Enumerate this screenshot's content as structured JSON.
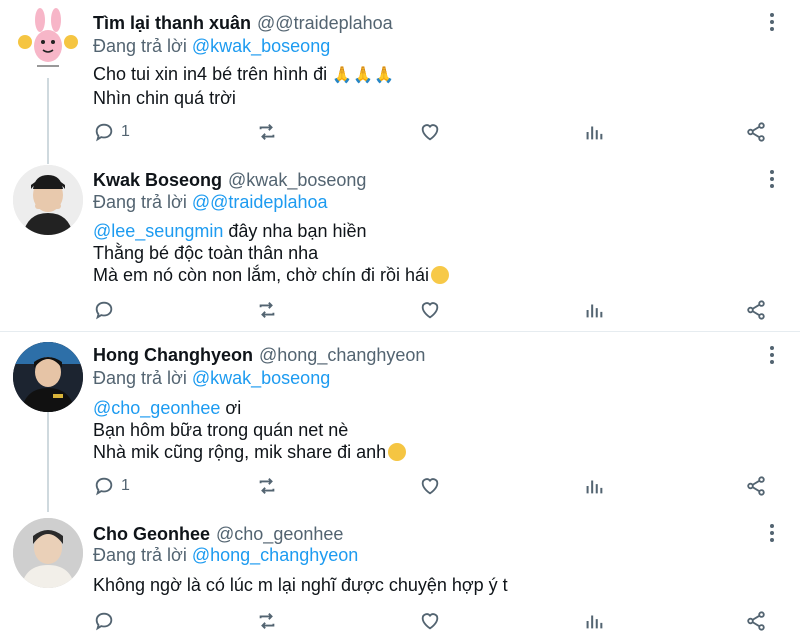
{
  "tweets": [
    {
      "name": "Tìm lại thanh xuân",
      "handle": "@@traideplahoa",
      "reply_prefix": "Đang trả lời",
      "reply_to": "@kwak_boseong",
      "lines": [
        "Cho tui xin in4 bé trên hình đi",
        "Nhìn chin quá trời"
      ],
      "line_suffix_emoji": [
        "pray-emoji",
        "",
        ""
      ],
      "reply_count": "1",
      "avatar": "cartoon-bunny-avatar"
    },
    {
      "name": "Kwak Boseong",
      "handle": "@kwak_boseong",
      "reply_prefix": "Đang trả lời",
      "reply_to": "@@traideplahoa",
      "mention": "@lee_seungmin",
      "lines": [
        "đây nha bạn hiền",
        "Thằng bé độc toàn thân nha",
        "Mà em nó còn non lắm, chờ chín đi rồi hái"
      ],
      "reply_count": "",
      "avatar": "person-avatar"
    },
    {
      "name": "Hong Changhyeon",
      "handle": "@hong_changhyeon",
      "reply_prefix": "Đang trả lời",
      "reply_to": "@kwak_boseong",
      "mention": "@cho_geonhee",
      "lines": [
        "ơi",
        "Bạn hôm bữa trong quán net nè",
        "Nhà mik cũng rộng, mik share đi anh"
      ],
      "reply_count": "1",
      "avatar": "person-avatar"
    },
    {
      "name": "Cho Geonhee",
      "handle": "@cho_geonhee",
      "reply_prefix": "Đang trả lời",
      "reply_to": "@hong_changhyeon",
      "lines": [
        "Không ngờ là có lúc m lại nghĩ được chuyện hợp ý t"
      ],
      "reply_count": "",
      "avatar": "person-avatar"
    }
  ],
  "colors": {
    "accent": "#1d9bf0",
    "muted": "#536471",
    "text": "#0f1419"
  }
}
